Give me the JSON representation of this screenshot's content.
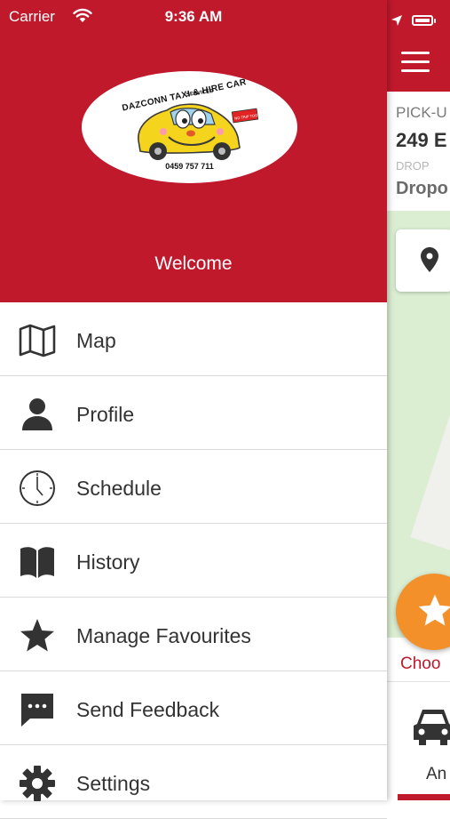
{
  "status_bar": {
    "carrier": "Carrier",
    "time": "9:36 AM"
  },
  "drawer": {
    "logo": {
      "title": "DAZCONN TAXI & HIRE CAR",
      "subtitle": "SERVICES",
      "phone": "0459 757 711",
      "sign": "NO TRIP TOO SHORT",
      "icon": "taxi-cartoon-logo"
    },
    "welcome": "Welcome",
    "menu": [
      {
        "label": "Map",
        "icon": "map-icon"
      },
      {
        "label": "Profile",
        "icon": "person-icon"
      },
      {
        "label": "Schedule",
        "icon": "clock-icon"
      },
      {
        "label": "History",
        "icon": "book-icon"
      },
      {
        "label": "Manage Favourites",
        "icon": "star-icon"
      },
      {
        "label": "Send Feedback",
        "icon": "chat-icon"
      },
      {
        "label": "Settings",
        "icon": "gear-icon"
      }
    ]
  },
  "background_screen": {
    "pickup_label": "PICK-U",
    "pickup_value": "249 E",
    "dropoff_label": "DROP",
    "dropoff_value": "Dropo",
    "choose_label": "Choo",
    "vehicle_label": "An"
  },
  "colors": {
    "brand_red": "#c0192c",
    "fab_orange": "#f4902a",
    "map_green": "#dbeed2"
  }
}
